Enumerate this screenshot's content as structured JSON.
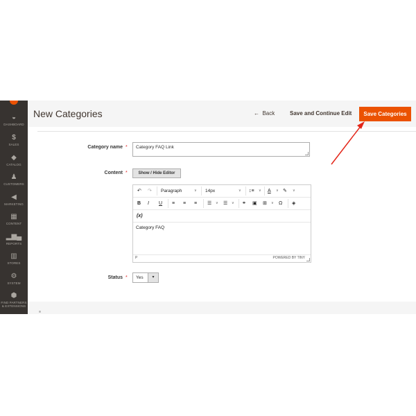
{
  "colors": {
    "accent": "#eb5202",
    "sidebar_bg": "#373330",
    "annotation": "#e32619"
  },
  "sidebar": {
    "items": [
      {
        "icon": "dashboard-icon",
        "label": "DASHBOARD"
      },
      {
        "icon": "dollar-icon",
        "label": "SALES"
      },
      {
        "icon": "box-icon",
        "label": "CATALOG"
      },
      {
        "icon": "person-icon",
        "label": "CUSTOMERS"
      },
      {
        "icon": "megaphone-icon",
        "label": "MARKETING"
      },
      {
        "icon": "content-icon",
        "label": "CONTENT"
      },
      {
        "icon": "bar-chart-icon",
        "label": "REPORTS"
      },
      {
        "icon": "store-icon",
        "label": "STORES"
      },
      {
        "icon": "gear-icon",
        "label": "SYSTEM"
      },
      {
        "icon": "partners-icon",
        "label": "FIND PARTNERS & EXTENSIONS"
      }
    ]
  },
  "header": {
    "title": "New Categories",
    "back_label": "Back",
    "save_continue_label": "Save and Continue Edit",
    "save_label": "Save Categories"
  },
  "form": {
    "category_name": {
      "label": "Category name",
      "value": "Category FAQ Link"
    },
    "content": {
      "label": "Content",
      "toggle_label": "Show / Hide Editor",
      "editor": {
        "block_format": "Paragraph",
        "font_size": "14px",
        "variable_label": "(x)",
        "body_text": "Category FAQ",
        "path": "P",
        "powered_by": "POWERED BY TINY"
      }
    },
    "status": {
      "label": "Status",
      "value": "Yes"
    }
  }
}
